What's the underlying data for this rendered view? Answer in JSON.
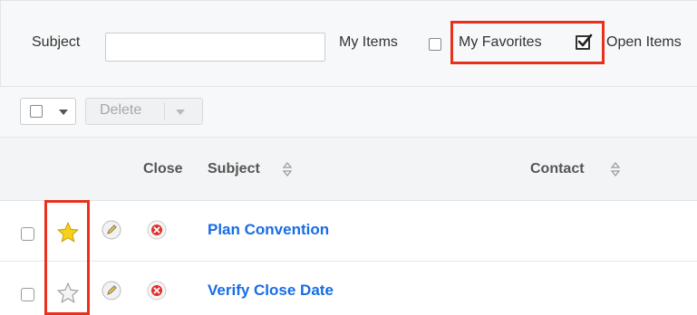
{
  "filters": {
    "subject_label": "Subject",
    "subject_value": "",
    "my_items_label": "My Items",
    "my_items_checked": false,
    "my_favorites_label": "My Favorites",
    "my_favorites_checked": true,
    "open_items_label": "Open Items"
  },
  "toolbar": {
    "delete_label": "Delete"
  },
  "columns": {
    "close": "Close",
    "subject": "Subject",
    "contact": "Contact"
  },
  "rows": [
    {
      "subject": "Plan Convention",
      "favorite": true
    },
    {
      "subject": "Verify Close Date",
      "favorite": false
    }
  ],
  "colors": {
    "highlight": "#e8301c",
    "link": "#176de5",
    "favorite_star": "#f7d21a",
    "close_icon": "#e0302a"
  }
}
